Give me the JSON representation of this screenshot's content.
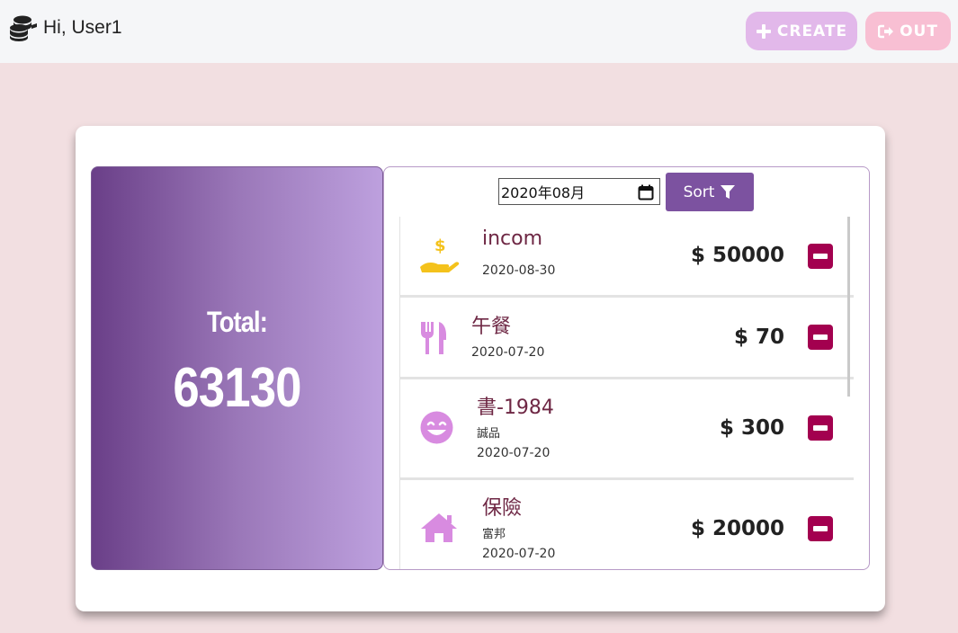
{
  "header": {
    "greeting": "Hi, User1",
    "create_label": "CREATE",
    "out_label": "OUT"
  },
  "total": {
    "label": "Total:",
    "value": "63130"
  },
  "filter": {
    "month_value": "2020年08月",
    "sort_label": "Sort"
  },
  "items": [
    {
      "icon": "hand-coin-icon",
      "name": "incom",
      "sub": "",
      "date": "2020-08-30",
      "amount": "$ 50000"
    },
    {
      "icon": "utensils-icon",
      "name": "午餐",
      "sub": "",
      "date": "2020-07-20",
      "amount": "$ 70"
    },
    {
      "icon": "smile-icon",
      "name": "書-1984",
      "sub": "誠品",
      "date": "2020-07-20",
      "amount": "$ 300"
    },
    {
      "icon": "home-icon",
      "name": "保險",
      "sub": "富邦",
      "date": "2020-07-20",
      "amount": "$ 20000"
    }
  ],
  "colors": {
    "background": "#f2dfe1",
    "accent_purple": "#7c52a0",
    "delete": "#a3004f",
    "item_name": "#6e2744"
  }
}
